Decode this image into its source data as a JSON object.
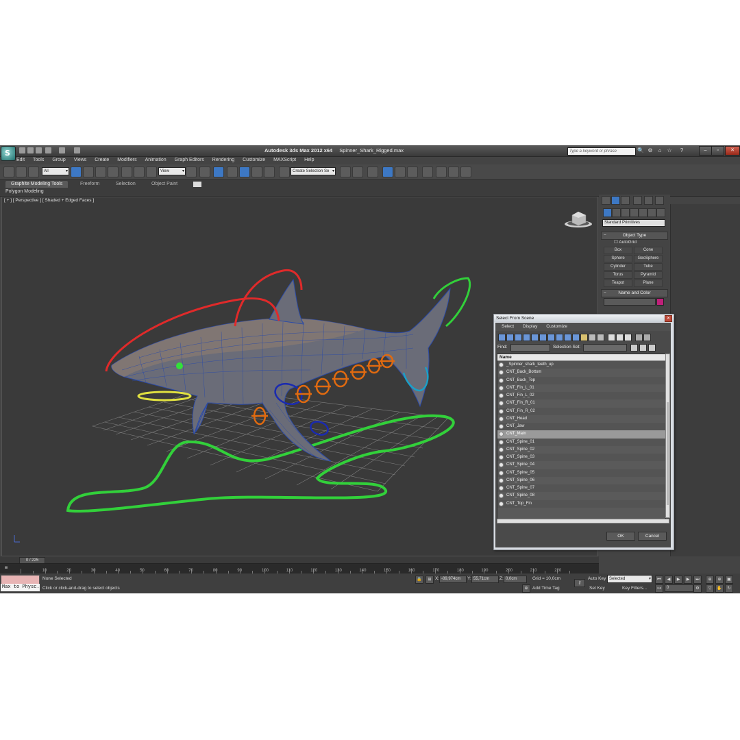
{
  "window": {
    "app_title": "Autodesk 3ds Max  2012 x64",
    "file_name": "Spinner_Shark_Rigged.max",
    "search_placeholder": "Type a keyword or phrase"
  },
  "menu": [
    "Edit",
    "Tools",
    "Group",
    "Views",
    "Create",
    "Modifiers",
    "Animation",
    "Graph Editors",
    "Rendering",
    "Customize",
    "MAXScript",
    "Help"
  ],
  "toolbar": {
    "filter_value": "All",
    "ref_coord_value": "View",
    "selection_set_placeholder": "Create Selection Se"
  },
  "ribbon": {
    "tabs": [
      "Graphite Modeling Tools",
      "Freeform",
      "Selection",
      "Object Paint"
    ],
    "subtab": "Polygon Modeling"
  },
  "viewport": {
    "label": "[ + ] [ Perspective ] [ Shaded + Edged Faces ]"
  },
  "command_panel": {
    "category_dropdown": "Standard Primitives",
    "object_type_title": "Object Type",
    "autogrid_label": "AutoGrid",
    "primitives": [
      "Box",
      "Cone",
      "Sphere",
      "GeoSphere",
      "Cylinder",
      "Tube",
      "Torus",
      "Pyramid",
      "Teapot",
      "Plane"
    ],
    "name_color_title": "Name and Color",
    "color_swatch": "#c0207a"
  },
  "select_dialog": {
    "title": "Select From Scene",
    "menu": [
      "Select",
      "Display",
      "Customize"
    ],
    "find_label": "Find:",
    "selection_set_label": "Selection Set:",
    "column_header": "Name",
    "items": [
      "_Spinner_shark_teeth_up",
      "CNT_Back_Bottom",
      "CNT_Back_Top",
      "CNT_Fin_L_01",
      "CNT_Fin_L_02",
      "CNT_Fin_R_01",
      "CNT_Fin_R_02",
      "CNT_Head",
      "CNT_Jaw",
      "CNT_Main",
      "CNT_Spine_01",
      "CNT_Spine_02",
      "CNT_Spine_03",
      "CNT_Spine_04",
      "CNT_Spine_05",
      "CNT_Spine_06",
      "CNT_Spine_07",
      "CNT_Spine_08",
      "CNT_Top_Fin"
    ],
    "selected_item": "CNT_Main",
    "ok_label": "OK",
    "cancel_label": "Cancel"
  },
  "timeline": {
    "frame_counter": "0 / 225",
    "tick_labels": [
      "10",
      "20",
      "30",
      "40",
      "50",
      "60",
      "70",
      "80",
      "90",
      "100",
      "110",
      "120",
      "130",
      "140",
      "150",
      "160",
      "170",
      "180",
      "190",
      "200",
      "210",
      "220"
    ]
  },
  "status": {
    "maxscript_text": "Max to Physc.",
    "selection_info": "None Selected",
    "prompt": "Click or click-and-drag to select objects",
    "x_value": "-89,974cm",
    "y_value": "55,71cm",
    "z_value": "0,0cm",
    "grid": "Grid = 10,0cm",
    "add_time_tag": "Add Time Tag",
    "auto_key": "Auto Key",
    "set_key": "Set Key",
    "key_mode_value": "Selected",
    "key_filters": "Key Filters...",
    "current_frame": "0"
  },
  "colors": {
    "red_control": "#e02a2a",
    "green_control": "#32d03a",
    "orange_control": "#e06a10",
    "blue_control": "#1a2ab0",
    "yellow_control": "#e0e040",
    "cyan_control": "#1aa0c8",
    "mesh_wire": "#2a4aa8"
  }
}
